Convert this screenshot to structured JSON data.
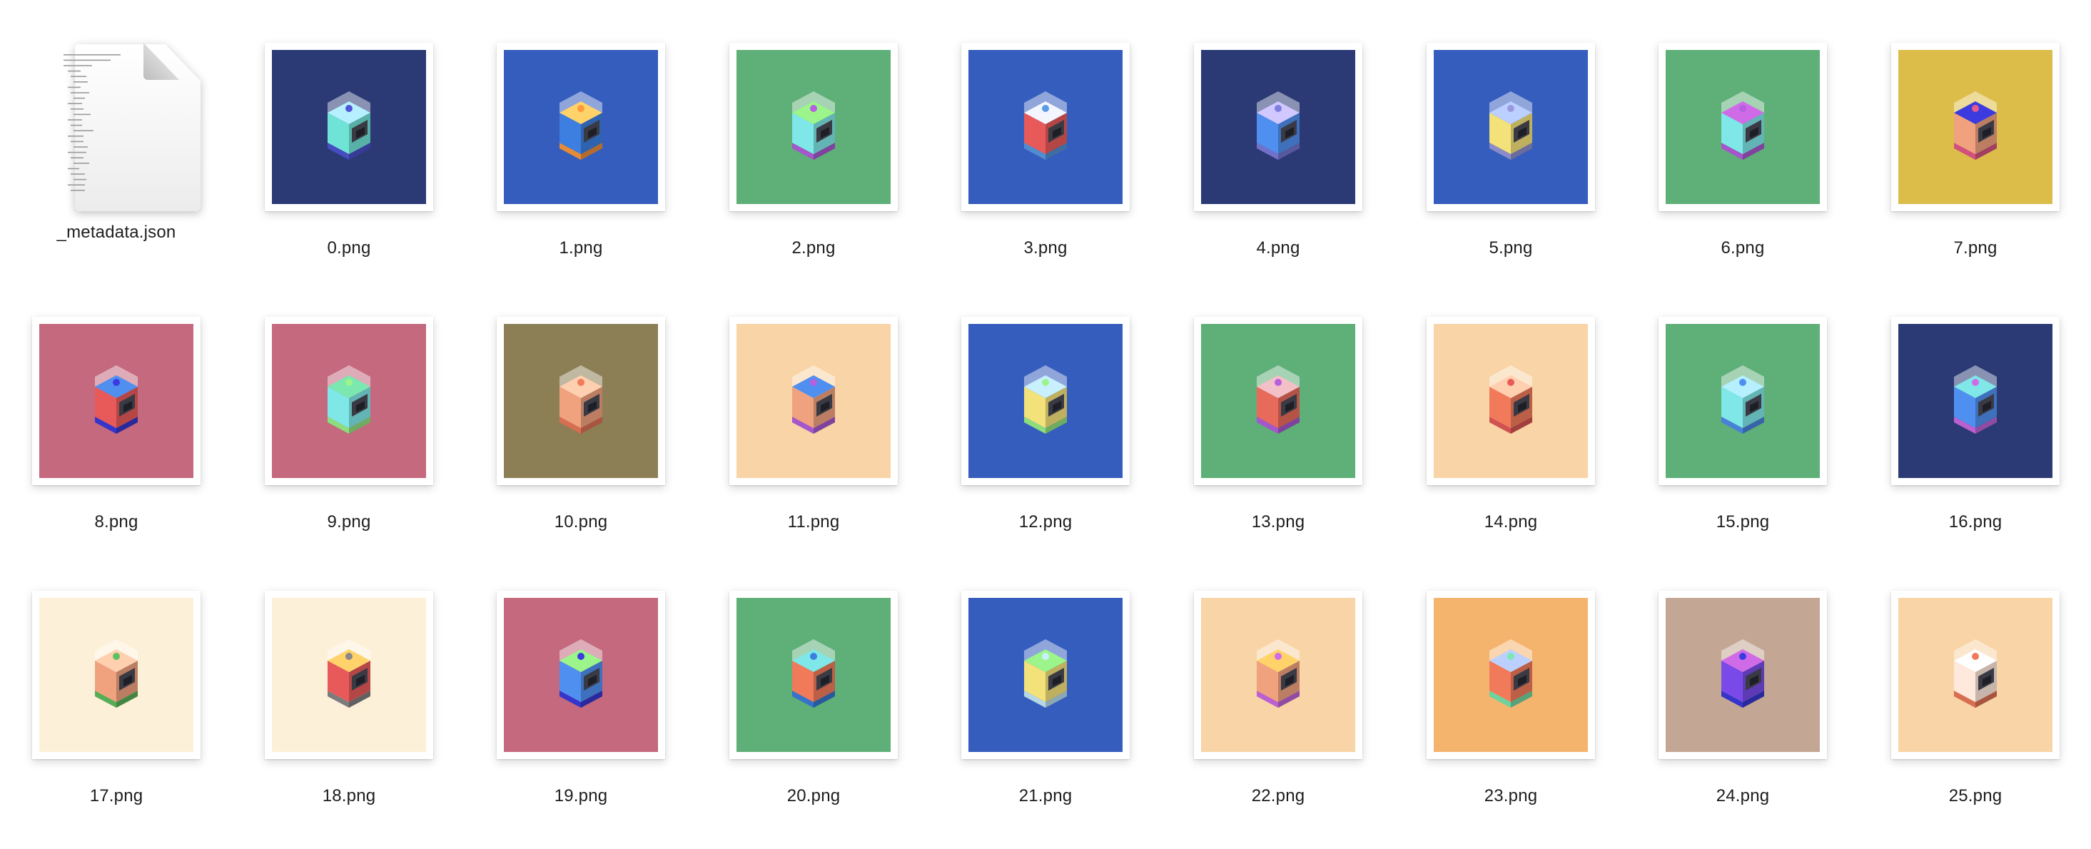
{
  "files": [
    {
      "name": "_metadata.json",
      "kind": "json-document",
      "icon": "document-icon"
    },
    {
      "name": "0.png",
      "bg": "#2b3a75",
      "body": "#6fe3d6",
      "top": "#b6f0ff",
      "accent": "#4e54d8"
    },
    {
      "name": "1.png",
      "bg": "#355dbd",
      "body": "#3c7fe0",
      "top": "#ffd36a",
      "accent": "#ff9a3d"
    },
    {
      "name": "2.png",
      "bg": "#5faf78",
      "body": "#7fe7e7",
      "top": "#9cf58a",
      "accent": "#b65fe0"
    },
    {
      "name": "3.png",
      "bg": "#355dbd",
      "body": "#e85a5a",
      "top": "#f4f6ff",
      "accent": "#5a9be8"
    },
    {
      "name": "4.png",
      "bg": "#2b3a75",
      "body": "#4f8ff0",
      "top": "#d0c8ff",
      "accent": "#7e7ee0"
    },
    {
      "name": "5.png",
      "bg": "#355dbd",
      "body": "#f3e17a",
      "top": "#bcd0ff",
      "accent": "#9a9adf"
    },
    {
      "name": "6.png",
      "bg": "#5faf78",
      "body": "#7fe7e7",
      "top": "#d06be8",
      "accent": "#b65fe0"
    },
    {
      "name": "7.png",
      "bg": "#dcbd4a",
      "body": "#f0a27e",
      "top": "#3b3be0",
      "accent": "#e85a8a"
    },
    {
      "name": "8.png",
      "bg": "#c4697e",
      "body": "#e85a5a",
      "top": "#4f8ff0",
      "accent": "#3b3be0"
    },
    {
      "name": "9.png",
      "bg": "#c4697e",
      "body": "#7fe7e7",
      "top": "#7be8b0",
      "accent": "#9cf58a"
    },
    {
      "name": "10.png",
      "bg": "#8c7f55",
      "body": "#f0a27e",
      "top": "#ffd0b0",
      "accent": "#f07a5a"
    },
    {
      "name": "11.png",
      "bg": "#f8d4a6",
      "body": "#f0a27e",
      "top": "#4f8ff0",
      "accent": "#b65fe0"
    },
    {
      "name": "12.png",
      "bg": "#355dbd",
      "body": "#f3e17a",
      "top": "#c8f0ff",
      "accent": "#9cf58a"
    },
    {
      "name": "13.png",
      "bg": "#5faf78",
      "body": "#e86a5a",
      "top": "#f4c0c8",
      "accent": "#b65fe0"
    },
    {
      "name": "14.png",
      "bg": "#f8d4a6",
      "body": "#f07a5a",
      "top": "#ffd0b0",
      "accent": "#e85a5a"
    },
    {
      "name": "15.png",
      "bg": "#5faf78",
      "body": "#7fe7e7",
      "top": "#b6f0ff",
      "accent": "#4f8ff0"
    },
    {
      "name": "16.png",
      "bg": "#2b3a75",
      "body": "#4f8ff0",
      "top": "#7fe7e7",
      "accent": "#d06be8"
    },
    {
      "name": "17.png",
      "bg": "#fdf0d8",
      "body": "#f0a27e",
      "top": "#ffd0b0",
      "accent": "#5fc060"
    },
    {
      "name": "18.png",
      "bg": "#fdf0d8",
      "body": "#e85a5a",
      "top": "#ffd36a",
      "accent": "#8a8a8a"
    },
    {
      "name": "19.png",
      "bg": "#c4697e",
      "body": "#4f8ff0",
      "top": "#9cf58a",
      "accent": "#3b3be0"
    },
    {
      "name": "20.png",
      "bg": "#5faf78",
      "body": "#f07a5a",
      "top": "#7fe7e7",
      "accent": "#3b7fe0"
    },
    {
      "name": "21.png",
      "bg": "#355dbd",
      "body": "#f3e17a",
      "top": "#9cf58a",
      "accent": "#c8f0ff"
    },
    {
      "name": "22.png",
      "bg": "#f8d4a6",
      "body": "#f0a27e",
      "top": "#ffd36a",
      "accent": "#d06be8"
    },
    {
      "name": "23.png",
      "bg": "#f5b46e",
      "body": "#f07a5a",
      "top": "#bcd0ff",
      "accent": "#7be8b0"
    },
    {
      "name": "24.png",
      "bg": "#c4a694",
      "body": "#7a4ae8",
      "top": "#d06be8",
      "accent": "#3b3be0"
    },
    {
      "name": "25.png",
      "bg": "#f8d4a6",
      "body": "#ffe8dc",
      "top": "#ffffff",
      "accent": "#f07a5a"
    }
  ]
}
